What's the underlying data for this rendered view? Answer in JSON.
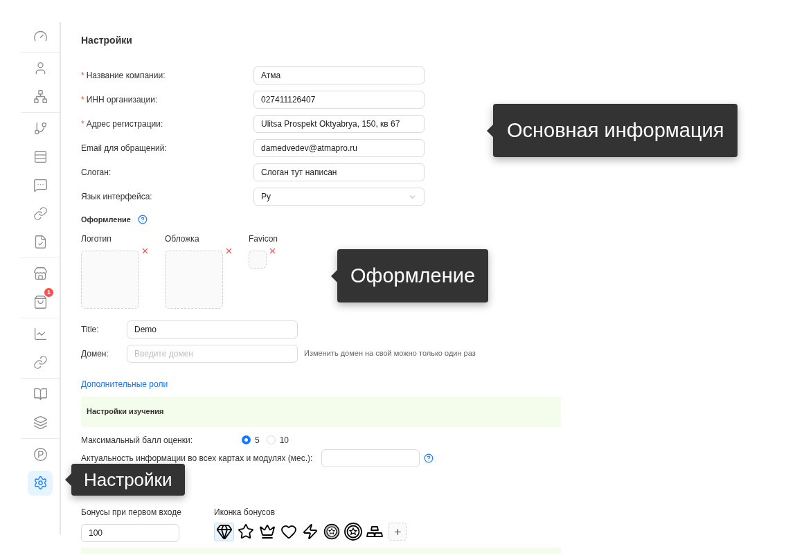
{
  "sidebar": {
    "groups": [
      [
        {
          "kind": "gauge",
          "selected": false
        }
      ],
      [
        {
          "kind": "user",
          "selected": false
        },
        {
          "kind": "network",
          "selected": false
        }
      ],
      [
        {
          "kind": "branch",
          "selected": false
        },
        {
          "kind": "rows",
          "selected": false
        },
        {
          "kind": "chat",
          "selected": false
        },
        {
          "kind": "link",
          "selected": false
        },
        {
          "kind": "document",
          "selected": false
        }
      ],
      [
        {
          "kind": "store",
          "selected": false
        },
        {
          "kind": "bag",
          "selected": false,
          "badge": "1"
        }
      ],
      [
        {
          "kind": "chart",
          "selected": false
        },
        {
          "kind": "link",
          "selected": false
        }
      ],
      [
        {
          "kind": "book",
          "selected": false
        },
        {
          "kind": "stack",
          "selected": false
        }
      ],
      [
        {
          "kind": "parking",
          "selected": false
        },
        {
          "kind": "settings",
          "selected": true
        }
      ]
    ]
  },
  "page_title": "Настройки",
  "required_mark": "*",
  "fields": [
    {
      "label": "Название компании:",
      "required": true,
      "kind": "text",
      "value": "Атма"
    },
    {
      "label": "ИНН организации:",
      "required": true,
      "kind": "text",
      "value": "027411126407"
    },
    {
      "label": "Адрес регистрации:",
      "required": true,
      "kind": "text",
      "value": "Ulitsa Prospekt Oktyabrya, 150, кв 67"
    },
    {
      "label": "Email для обращений:",
      "required": false,
      "kind": "text",
      "value": "damedvedev@atmapro.ru"
    },
    {
      "label": "Слоган:",
      "required": false,
      "kind": "text",
      "value": "Слоган тут написан"
    },
    {
      "label": "Язык интерфейса:",
      "required": false,
      "kind": "select",
      "value": "Ру"
    }
  ],
  "design": {
    "title": "Оформление",
    "uploads": [
      {
        "label": "Логотип",
        "kind": "image"
      },
      {
        "label": "Обложка",
        "kind": "image"
      },
      {
        "label": "Favicon",
        "kind": "favicon"
      }
    ]
  },
  "title_field": {
    "label": "Title:",
    "value": "Demo"
  },
  "domain_field": {
    "label": "Домен:",
    "placeholder": "Введите домен",
    "hint": "Изменить домен на свой можно только один раз"
  },
  "roles_link": "Дополнительные роли",
  "study_section": {
    "title": "Настройки изучения"
  },
  "max_score": {
    "label": "Максимальный балл оценки:",
    "options": [
      {
        "label": "5",
        "selected": true
      },
      {
        "label": "10",
        "selected": false
      }
    ]
  },
  "relevance": {
    "label": "Актуальность информации во всех картах и модулях (мес.):"
  },
  "bonus": {
    "label": "Бонусы при первом входе",
    "value": "100"
  },
  "bonus_icon": {
    "label": "Иконка бонусов",
    "options": [
      {
        "kind": "diamond",
        "selected": true
      },
      {
        "kind": "star",
        "selected": false
      },
      {
        "kind": "crown",
        "selected": false
      },
      {
        "kind": "heart",
        "selected": false
      },
      {
        "kind": "bolt",
        "selected": false
      },
      {
        "kind": "coin",
        "selected": false
      },
      {
        "kind": "medal",
        "selected": false
      },
      {
        "kind": "bars",
        "selected": false
      }
    ]
  },
  "tooltips": [
    {
      "text": "Основная информация"
    },
    {
      "text": "Оформление"
    },
    {
      "text": "Настройки"
    }
  ]
}
